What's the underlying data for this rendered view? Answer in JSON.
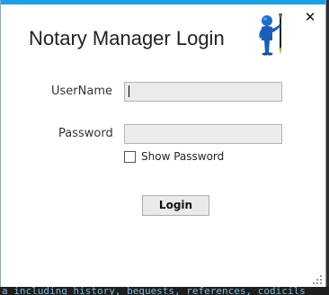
{
  "window": {
    "title": "Notary Manager Login",
    "accent_color": "#1ba1e2",
    "close_glyph": "✕",
    "logo_icon": "notary-pen-figure-icon"
  },
  "form": {
    "username_label": "UserName",
    "username_value": "",
    "password_label": "Password",
    "password_value": "",
    "show_password_label": "Show Password",
    "show_password_checked": false,
    "login_label": "Login"
  },
  "background": {
    "partial_text": "a including history, bequests, references, codicils"
  }
}
